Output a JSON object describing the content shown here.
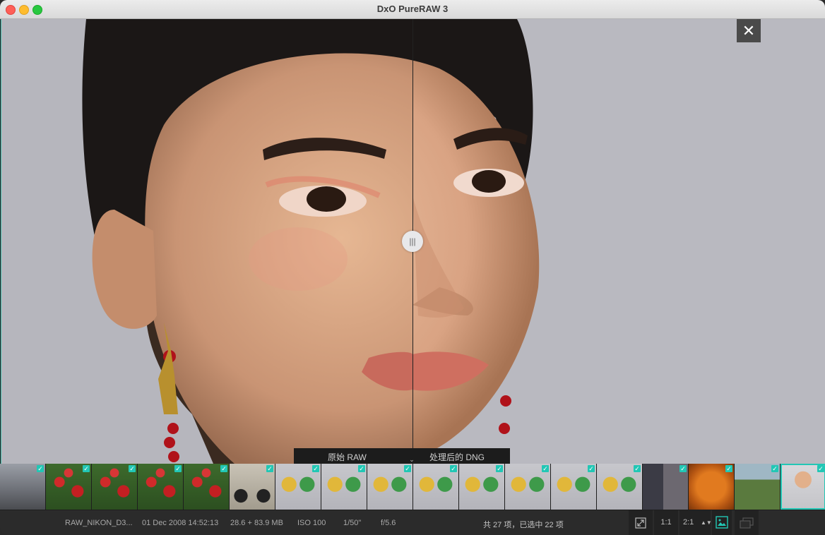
{
  "window": {
    "title": "DxO PureRAW 3"
  },
  "viewer": {
    "close_label": "✕",
    "split_handle_label": "|||",
    "compare": {
      "left_label": "原始 RAW",
      "right_label": "处理后的 DNG"
    },
    "collapse_label": "⌄"
  },
  "filmstrip": {
    "thumbnails": [
      {
        "kind": "landscape-gray",
        "checked": true,
        "selected": false
      },
      {
        "kind": "red-flowers",
        "checked": true,
        "selected": false
      },
      {
        "kind": "red-flowers",
        "checked": true,
        "selected": false
      },
      {
        "kind": "red-flowers",
        "checked": true,
        "selected": false
      },
      {
        "kind": "red-flowers",
        "checked": true,
        "selected": false
      },
      {
        "kind": "motorcycle",
        "checked": true,
        "selected": false
      },
      {
        "kind": "toys",
        "checked": true,
        "selected": false
      },
      {
        "kind": "toys",
        "checked": true,
        "selected": false
      },
      {
        "kind": "toys",
        "checked": true,
        "selected": false
      },
      {
        "kind": "toys",
        "checked": true,
        "selected": false
      },
      {
        "kind": "toys",
        "checked": true,
        "selected": false
      },
      {
        "kind": "toys",
        "checked": true,
        "selected": false
      },
      {
        "kind": "toys",
        "checked": true,
        "selected": false
      },
      {
        "kind": "toys",
        "checked": true,
        "selected": false
      },
      {
        "kind": "people-indoor",
        "checked": true,
        "selected": false
      },
      {
        "kind": "orange",
        "checked": true,
        "selected": false
      },
      {
        "kind": "trees",
        "checked": true,
        "selected": false
      },
      {
        "kind": "portrait",
        "checked": true,
        "selected": true
      }
    ],
    "check_glyph": "✓"
  },
  "status": {
    "filename": "RAW_NIKON_D3...",
    "date": "01 Dec 2008 14:52:13",
    "size": "28.6 + 83.9 MB",
    "iso": "ISO 100",
    "shutter": "1/50\"",
    "aperture": "f/5.6",
    "selection": "共 27 项，已选中 22 项",
    "zoom_1to1": "1:1",
    "zoom_level": "2:1",
    "fit_icon": "expand-icon",
    "single_view_icon": "single-image-icon",
    "compare_view_icon": "stack-view-icon"
  },
  "colors": {
    "accent": "#22c7b5",
    "background": "#b6b6bd"
  }
}
